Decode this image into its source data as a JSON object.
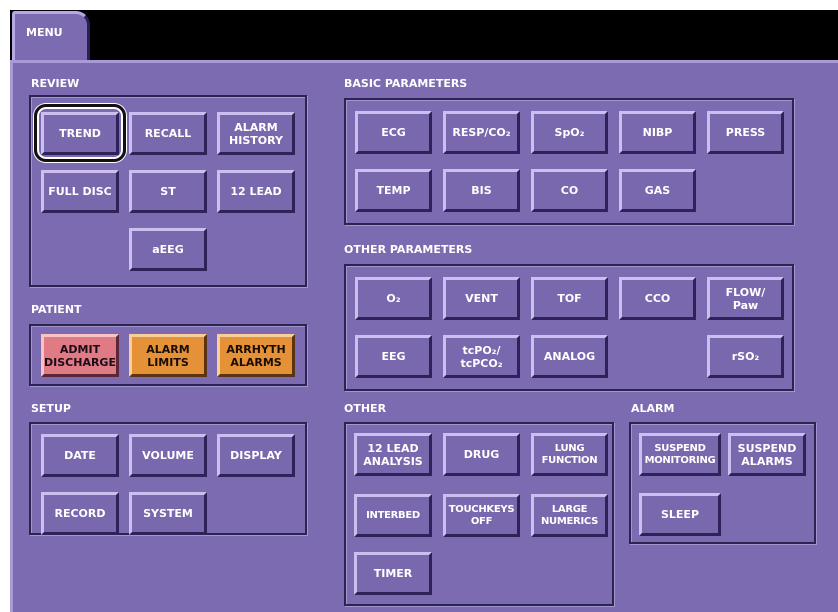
{
  "tab": {
    "label": "MENU"
  },
  "sections": {
    "review": "REVIEW",
    "patient": "PATIENT",
    "setup": "SETUP",
    "basic_parameters": "BASIC PARAMETERS",
    "other_parameters": "OTHER PARAMETERS",
    "other": "OTHER",
    "alarm": "ALARM"
  },
  "review": {
    "trend": "TREND",
    "recall": "RECALL",
    "alarm_history": "ALARM\nHISTORY",
    "full_disc": "FULL DISC",
    "st": "ST",
    "twelve_lead": "12 LEAD",
    "aeeg": "aEEG"
  },
  "patient": {
    "admit_discharge": "ADMIT\nDISCHARGE",
    "alarm_limits": "ALARM\nLIMITS",
    "arrhyth_alarms": "ARRHYTH\nALARMS"
  },
  "setup": {
    "date": "DATE",
    "volume": "VOLUME",
    "display": "DISPLAY",
    "record": "RECORD",
    "system": "SYSTEM"
  },
  "basic": {
    "ecg": "ECG",
    "resp_co2": "RESP/CO₂",
    "spo2": "SpO₂",
    "nibp": "NIBP",
    "press": "PRESS",
    "temp": "TEMP",
    "bis": "BIS",
    "co": "CO",
    "gas": "GAS"
  },
  "other_params": {
    "o2": "O₂",
    "vent": "VENT",
    "tof": "TOF",
    "cco": "CCO",
    "flow_paw": "FLOW/\nPaw",
    "eeg": "EEG",
    "tcpo2": "tcPO₂/\ntcPCO₂",
    "analog": "ANALOG",
    "rso2": "rSO₂"
  },
  "other": {
    "lead_analysis": "12 LEAD\nANALYSIS",
    "drug": "DRUG",
    "lung_function": "LUNG\nFUNCTION",
    "interbed": "INTERBED",
    "touchkeys_off": "TOUCHKEYS\nOFF",
    "large_numerics": "LARGE\nNUMERICS",
    "timer": "TIMER"
  },
  "alarm": {
    "suspend_monitoring": "SUSPEND\nMONITORING",
    "suspend_alarms": "SUSPEND\nALARMS",
    "sleep": "SLEEP"
  },
  "colors": {
    "panel": "#7d6bb2",
    "admit": "#e07a84",
    "alarm_limits": "#e59137"
  }
}
